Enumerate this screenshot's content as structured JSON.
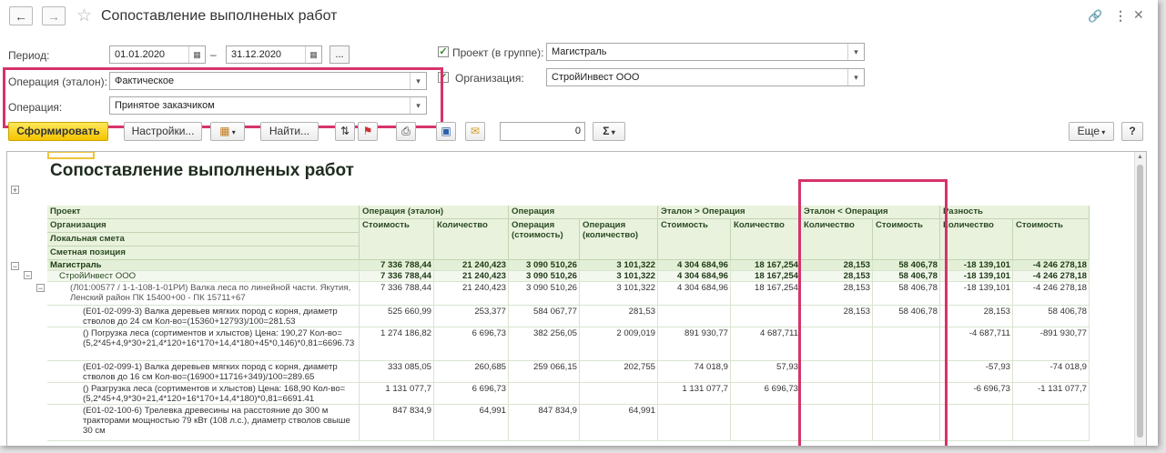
{
  "window": {
    "title": "Сопоставление выполненых работ"
  },
  "filters": {
    "period_label": "Период:",
    "date_from": "01.01.2020",
    "date_sep": "–",
    "date_to": "31.12.2020",
    "ellipsis": "...",
    "project_label": "Проект (в группе):",
    "project_value": "Магистраль",
    "org_label": "Организация:",
    "org_value": "СтройИнвест ООО",
    "op_ref_label": "Операция (эталон):",
    "op_ref_value": "Фактическое",
    "op_label": "Операция:",
    "op_value": "Принятое заказчиком"
  },
  "toolbar": {
    "generate": "Сформировать",
    "settings": "Настройки...",
    "find": "Найти...",
    "sum_value": "0",
    "sigma": "Σ",
    "more": "Еще",
    "help": "?"
  },
  "report": {
    "title": "Сопоставление выполненых работ",
    "hdr_project": "Проект",
    "hdr_org": "Организация",
    "hdr_local": "Локальная смета",
    "hdr_pos": "Сметная позиция",
    "grp_ref": "Операция (эталон)",
    "grp_op": "Операция",
    "grp_gt": "Эталон > Операция",
    "grp_lt": "Эталон < Операция",
    "grp_diff": "Разность",
    "sub_ref_cost": "Стоимость",
    "sub_ref_qty": "Количество",
    "sub_op_cost": "Операция (стоимость)",
    "sub_op_qty": "Операция (количество)",
    "sub_gt_cost": "Стоимость",
    "sub_gt_qty": "Количество",
    "sub_lt_qty": "Количество",
    "sub_lt_cost": "Стоимость",
    "sub_diff_qty": "Количество",
    "sub_diff_cost": "Стоимость",
    "rows": [
      {
        "name": "Магистраль",
        "v": [
          "7 336 788,44",
          "21 240,423",
          "3 090 510,26",
          "3 101,322",
          "4 304 684,96",
          "18 167,254",
          "28,153",
          "58 406,78",
          "-18 139,101",
          "-4 246 278,18"
        ]
      },
      {
        "name": "СтройИнвест ООО",
        "v": [
          "7 336 788,44",
          "21 240,423",
          "3 090 510,26",
          "3 101,322",
          "4 304 684,96",
          "18 167,254",
          "28,153",
          "58 406,78",
          "-18 139,101",
          "-4 246 278,18"
        ]
      },
      {
        "name": "(Л01:00577 / 1-1-108-1-01РИ) Валка леса по линейной части. Якутия, Ленский район ПК 15400+00 - ПК 15711+67",
        "v": [
          "7 336 788,44",
          "21 240,423",
          "3 090 510,26",
          "3 101,322",
          "4 304 684,96",
          "18 167,254",
          "28,153",
          "58 406,78",
          "-18 139,101",
          "-4 246 278,18"
        ]
      },
      {
        "name": "(Е01-02-099-3) Валка деревьев мягких пород с корня, диаметр стволов до 24 см Кол-во=(15360+12793)/100=281.53",
        "v": [
          "525 660,99",
          "253,377",
          "584 067,77",
          "281,53",
          "",
          "",
          "28,153",
          "58 406,78",
          "28,153",
          "58 406,78"
        ]
      },
      {
        "name": "() Погрузка леса (сортиментов и хлыстов)  Цена: 190,27 Кол-во=(5,2*45+4,9*30+21,4*120+16*170+14,4*180+45*0,146)*0,81=6696.73",
        "v": [
          "1 274 186,82",
          "6 696,73",
          "382 256,05",
          "2 009,019",
          "891 930,77",
          "4 687,711",
          "",
          "",
          "-4 687,711",
          "-891 930,77"
        ]
      },
      {
        "name": "(Е01-02-099-1) Валка деревьев мягких пород с корня, диаметр стволов до 16 см Кол-во=(16900+11716+349)/100=289.65",
        "v": [
          "333 085,05",
          "260,685",
          "259 066,15",
          "202,755",
          "74 018,9",
          "57,93",
          "",
          "",
          "-57,93",
          "-74 018,9"
        ]
      },
      {
        "name": "() Разгрузка леса (сортиментов и хлыстов)  Цена: 168,90 Кол-во=(5,2*45+4,9*30+21,4*120+16*170+14,4*180)*0,81=6691.41",
        "v": [
          "1 131 077,7",
          "6 696,73",
          "",
          "",
          "1 131 077,7",
          "6 696,73",
          "",
          "",
          "-6 696,73",
          "-1 131 077,7"
        ]
      },
      {
        "name": "(Е01-02-100-6) Трелевка древесины на расстояние до 300 м тракторами мощностью 79 кВт (108 л.с.), диаметр стволов свыше 30 см",
        "v": [
          "847 834,9",
          "64,991",
          "847 834,9",
          "64,991",
          "",
          "",
          "",
          "",
          "",
          ""
        ]
      }
    ]
  }
}
